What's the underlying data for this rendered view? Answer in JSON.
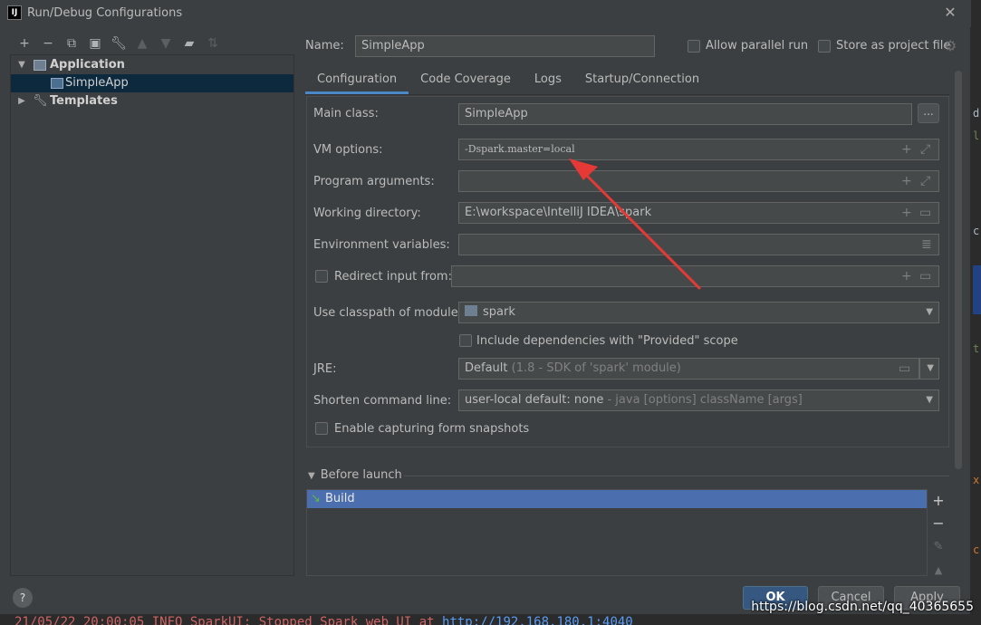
{
  "window": {
    "app_icon": "IJ",
    "title": "Run/Debug Configurations"
  },
  "toolbar": {
    "icons": [
      "add-icon",
      "remove-icon",
      "copy-icon",
      "save-icon",
      "wrench-icon",
      "move-up-icon",
      "move-down-icon",
      "new-folder-icon",
      "sort-icon"
    ]
  },
  "tree": {
    "application_label": "Application",
    "simpleapp_label": "SimpleApp",
    "templates_label": "Templates"
  },
  "header": {
    "name_label": "Name:",
    "name_value": "SimpleApp",
    "allow_parallel_label": "Allow parallel run",
    "store_project_label": "Store as project file"
  },
  "tabs": [
    "Configuration",
    "Code Coverage",
    "Logs",
    "Startup/Connection"
  ],
  "form": {
    "main_class_label": "Main class:",
    "main_class_value": "SimpleApp",
    "browse_label": "...",
    "vm_options_label": "VM options:",
    "vm_options_value": "-Dspark.master=local",
    "program_args_label": "Program arguments:",
    "working_dir_label": "Working directory:",
    "working_dir_value": "E:\\workspace\\IntelliJ IDEA\\spark",
    "env_vars_label": "Environment variables:",
    "redirect_label": "Redirect input from:",
    "classpath_label": "Use classpath of module:",
    "classpath_value": "spark",
    "include_deps_label": "Include dependencies with \"Provided\" scope",
    "jre_label": "JRE:",
    "jre_value": "Default",
    "jre_hint": "(1.8 - SDK of 'spark' module)",
    "shorten_label": "Shorten command line:",
    "shorten_value": "user-local default: none",
    "shorten_hint": "- java [options] className [args]",
    "snapshots_label": "Enable capturing form snapshots"
  },
  "before_launch": {
    "header": "Before launch",
    "item": "Build"
  },
  "buttons": {
    "help": "?",
    "ok": "OK",
    "cancel": "Cancel",
    "apply": "Apply"
  },
  "console": {
    "text": "21/05/22 20:00:05 INFO SparkUI: Stopped Spark web UI at ",
    "link": "http://192.168.180.1:4040"
  },
  "watermark": "https://blog.csdn.net/qq_40365655",
  "colors": {
    "accent": "#4a88c7",
    "selection": "#4b6eaf",
    "tree_selection": "#0d293e",
    "ok_button": "#365880",
    "annotation_arrow": "#e53935"
  }
}
